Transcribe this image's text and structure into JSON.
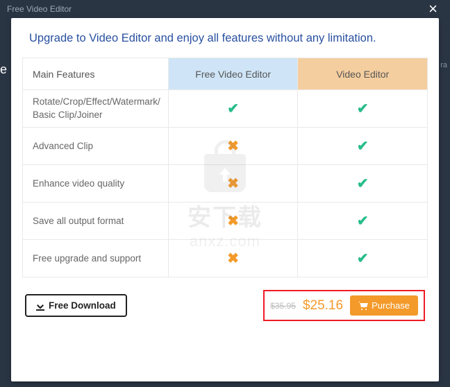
{
  "titlebar": {
    "title": "Free Video Editor"
  },
  "headline": "Upgrade to Video Editor and enjoy all features without any limitation.",
  "columns": {
    "c1": "Main Features",
    "c2": "Free Video Editor",
    "c3": "Video Editor"
  },
  "features": {
    "f1a": "Rotate/Crop/Effect/Watermark/",
    "f1b": "Basic Clip/Joiner",
    "f2": "Advanced Clip",
    "f3": "Enhance video quality",
    "f4": "Save all output format",
    "f5": "Free upgrade and support"
  },
  "marks": {
    "check": "✔",
    "cross": "✖"
  },
  "footer": {
    "download": "Free Download",
    "old_price": "$35.95",
    "new_price": "$25.16",
    "purchase": "Purchase"
  },
  "watermark": {
    "cn": "安下载",
    "domain": "anxz.com"
  },
  "edge": {
    "right": "ra",
    "left": "e"
  }
}
